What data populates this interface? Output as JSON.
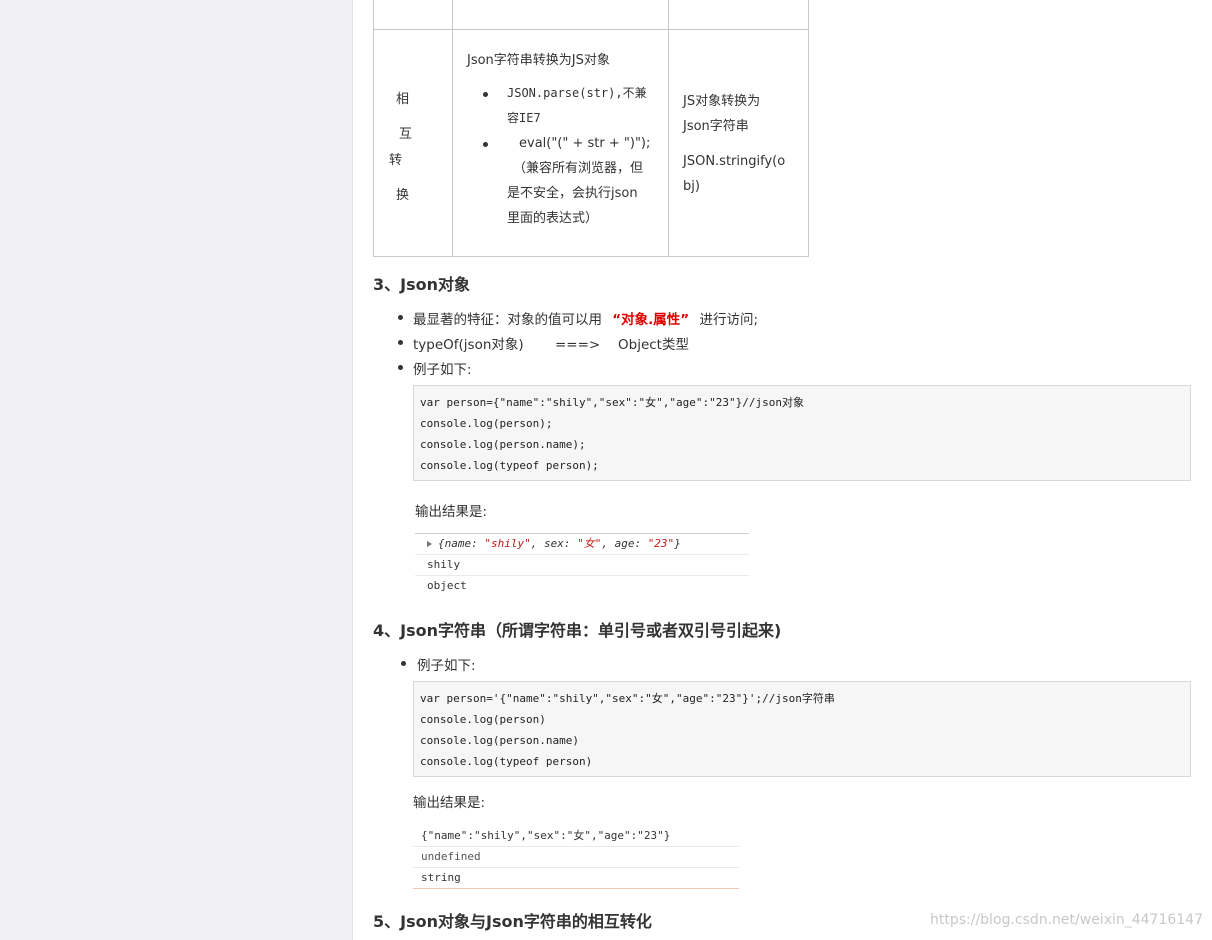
{
  "table": {
    "row_label_chars": [
      "相",
      "互",
      "转",
      "换"
    ],
    "col2_title": "Json字符串转换为JS对象",
    "col2_items": [
      [
        "JSON.parse(str),不兼",
        "容IE7"
      ],
      [
        "eval(\"(\" + str + \")\");",
        "（兼容所有浏览器，但",
        "是不安全，会执行json",
        "里面的表达式）"
      ]
    ],
    "col3_lines1": [
      "JS对象转换为",
      "Json字符串"
    ],
    "col3_lines2": [
      "JSON.stringify(o",
      "bj)"
    ]
  },
  "section3": {
    "heading": "3、Json对象",
    "bullet1_prefix": "最显著的特征：对象的值可以用",
    "bullet1_highlight": "“对象.属性”",
    "bullet1_suffix": "进行访问;",
    "bullet2": "typeOf(json对象)　　 ===>　 Object类型",
    "bullet3": "例子如下:",
    "code": [
      "var person={\"name\":\"shily\",\"sex\":\"女\",\"age\":\"23\"}//json对象",
      "console.log(person);",
      "console.log(person.name);",
      "console.log(typeof person);"
    ],
    "output_label": "输出结果是:",
    "console": {
      "obj_prefix": "{name: ",
      "name_val": "\"shily\"",
      "sep1": ", sex: ",
      "sex_val": "\"女\"",
      "sep2": ", age: ",
      "age_val": "\"23\"",
      "obj_suffix": "}",
      "line2": "shily",
      "line3": "object"
    }
  },
  "section4": {
    "heading": "4、Json字符串（所谓字符串：单引号或者双引号引起来)",
    "bullet1": "例子如下:",
    "code": [
      "var person='{\"name\":\"shily\",\"sex\":\"女\",\"age\":\"23\"}';//json字符串",
      "console.log(person)",
      "console.log(person.name)",
      "console.log(typeof person)"
    ],
    "output_label": "输出结果是:",
    "console_lines": [
      "{\"name\":\"shily\",\"sex\":\"女\",\"age\":\"23\"}",
      "undefined",
      "string"
    ]
  },
  "section5": {
    "heading": "5、Json对象与Json字符串的相互转化"
  },
  "watermark": "https://blog.csdn.net/weixin_44716147"
}
